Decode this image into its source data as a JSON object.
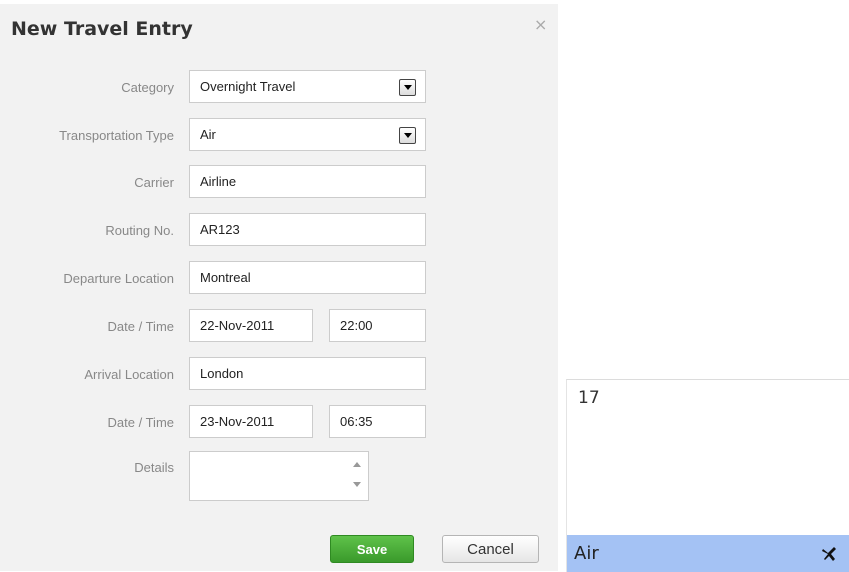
{
  "dialog": {
    "title": "New Travel Entry",
    "close_glyph": "×",
    "fields": {
      "category": {
        "label": "Category",
        "value": "Overnight Travel"
      },
      "transportation_type": {
        "label": "Transportation Type",
        "value": "Air"
      },
      "carrier": {
        "label": "Carrier",
        "value": "Airline"
      },
      "routing_no": {
        "label": "Routing No.",
        "value": "AR123"
      },
      "departure_location": {
        "label": "Departure Location",
        "value": "Montreal"
      },
      "departure_datetime": {
        "label": "Date / Time",
        "date": "22-Nov-2011",
        "time": "22:00"
      },
      "arrival_location": {
        "label": "Arrival Location",
        "value": "London"
      },
      "arrival_datetime": {
        "label": "Date / Time",
        "date": "23-Nov-2011",
        "time": "06:35"
      },
      "details": {
        "label": "Details",
        "value": ""
      }
    },
    "buttons": {
      "save_label": "Save",
      "cancel_label": "Cancel"
    }
  },
  "calendar": {
    "day_number": "17",
    "event": {
      "label": "Air",
      "icon": "airplane-icon"
    }
  },
  "colors": {
    "save_button": "#4caf3a",
    "event_highlight": "#a4c2f4",
    "dialog_bg": "#f2f2f2"
  }
}
